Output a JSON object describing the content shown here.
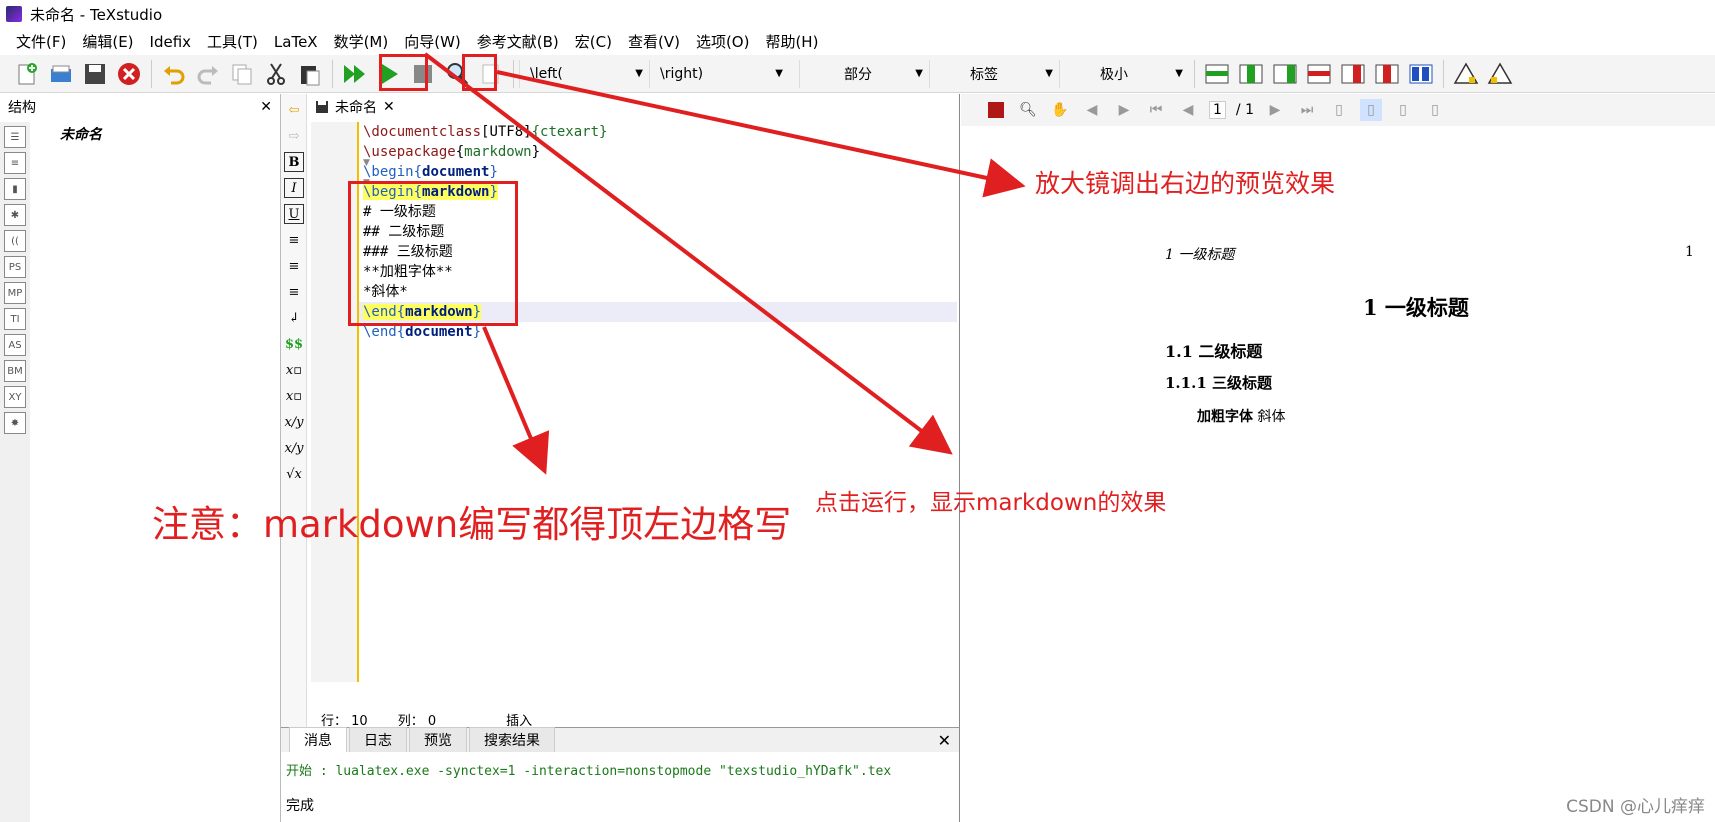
{
  "window": {
    "title": "未命名 - TeXstudio"
  },
  "menu": [
    "文件(F)",
    "编辑(E)",
    "Idefix",
    "工具(T)",
    "LaTeX",
    "数学(M)",
    "向导(W)",
    "参考文献(B)",
    "宏(C)",
    "查看(V)",
    "选项(O)",
    "帮助(H)"
  ],
  "toolbar": {
    "combos": [
      "\\left(",
      "\\right)",
      "部分",
      "标签",
      "极小"
    ]
  },
  "structure": {
    "title": "结构",
    "item": "未命名",
    "side_icons": [
      "PS",
      "MP",
      "TI",
      "AS",
      "BM",
      "XY"
    ]
  },
  "editor": {
    "tab": "未命名",
    "status": {
      "line": "行： 10",
      "col": "列： 0",
      "mode": "插入"
    }
  },
  "messages": {
    "tabs": [
      "消息",
      "日志",
      "预览",
      "搜索结果"
    ],
    "command": "开始 : lualatex.exe -synctex=1 -interaction=nonstopmode \"texstudio_hYDafk\".tex",
    "done": "完成"
  },
  "viewer": {
    "page": "1",
    "total": "/ 1",
    "header_left": "1   一级标题",
    "header_right": "1",
    "h1": "1   一级标题",
    "h2": "1.1   二级标题",
    "h3": "1.1.1   三级标题",
    "body_bold": "加粗字体",
    "body_italic": "斜体"
  },
  "annotations": {
    "magnifier": "放大镜调出右边的预览效果",
    "run": "点击运行，显示markdown的效果",
    "note": "注意：markdown编写都得顶左边格写"
  },
  "watermark": "CSDN @心儿痒痒"
}
